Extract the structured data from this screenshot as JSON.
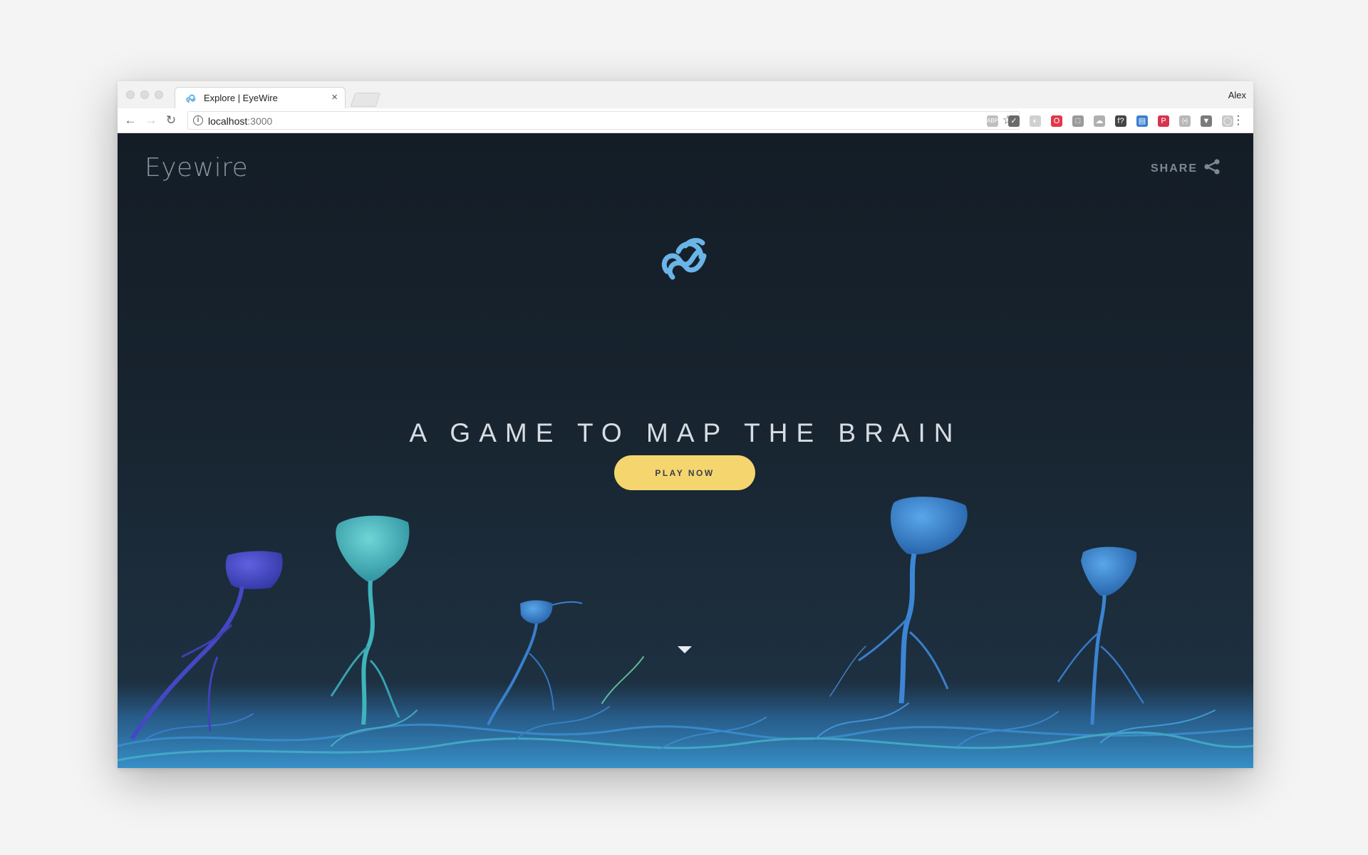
{
  "browser": {
    "tab": {
      "title": "Explore | EyeWire",
      "close_glyph": "×",
      "favicon": "eyewire-logo-icon"
    },
    "profile_name": "Alex",
    "nav": {
      "back_glyph": "←",
      "forward_glyph": "→",
      "reload_glyph": "↻"
    },
    "address": {
      "host": "localhost",
      "port": ":3000",
      "info_glyph": "i"
    },
    "bookmark_glyph": "☆",
    "menu_glyph": "⋮",
    "extensions": [
      {
        "name": "abp-extension-icon",
        "glyph": "ABP",
        "color": "#bfbfbf"
      },
      {
        "name": "pocket-extension-icon",
        "glyph": "✓",
        "color": "#6a6a6a"
      },
      {
        "name": "ghost-extension-icon",
        "glyph": "◐",
        "color": "#d0d0d0"
      },
      {
        "name": "opera-extension-icon",
        "glyph": "O",
        "color": "#e0384a"
      },
      {
        "name": "box-extension-icon",
        "glyph": "□",
        "color": "#9a9a9a"
      },
      {
        "name": "cloud-extension-icon",
        "glyph": "☁",
        "color": "#b0b0b0"
      },
      {
        "name": "fonts-extension-icon",
        "glyph": "f?",
        "color": "#444444"
      },
      {
        "name": "window-extension-icon",
        "glyph": "▤",
        "color": "#3a7fd0"
      },
      {
        "name": "pinterest-extension-icon",
        "glyph": "P",
        "color": "#d8344d"
      },
      {
        "name": "code-extension-icon",
        "glyph": "{•}",
        "color": "#b8b8b8"
      },
      {
        "name": "vue-extension-icon",
        "glyph": "▼",
        "color": "#7a7a7a"
      },
      {
        "name": "chat-extension-icon",
        "glyph": "◯",
        "color": "#c8c8c8"
      }
    ]
  },
  "page": {
    "logo_text": "Eyewire",
    "share_label": "SHARE",
    "headline": "A GAME TO MAP THE BRAIN",
    "play_label": "PLAY NOW"
  },
  "colors": {
    "accent_yellow": "#f5d56e",
    "brand_blue": "#6ab4e8",
    "page_bg_top": "#141d26",
    "page_bg_bottom": "#1f3447"
  }
}
